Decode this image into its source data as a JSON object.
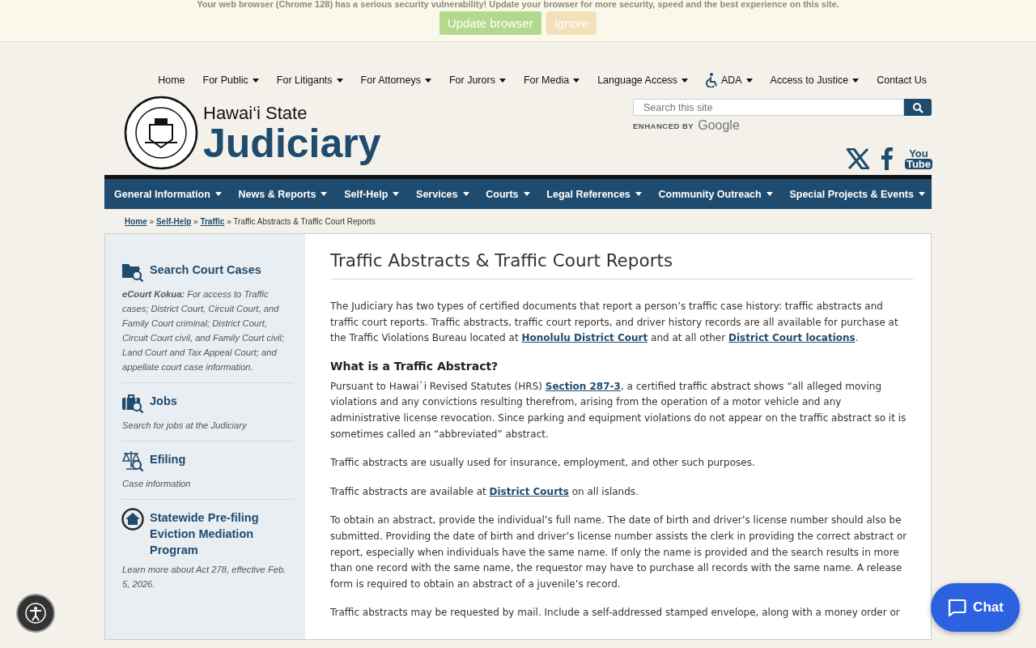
{
  "banner": {
    "message": "Your web browser (Chrome 128) has a serious security vulnerability! Update your browser for more security, speed and the best experience on this site.",
    "buttons": [
      {
        "label": "Update browser",
        "kind": "primary"
      },
      {
        "label": "Ignore",
        "kind": "secondary"
      }
    ]
  },
  "top_nav": [
    {
      "label": "Home",
      "kind": "link"
    },
    {
      "label": "For Public",
      "kind": "menu"
    },
    {
      "label": "For Litigants",
      "kind": "menu"
    },
    {
      "label": "For Attorneys",
      "kind": "menu"
    },
    {
      "label": "For Jurors",
      "kind": "menu"
    },
    {
      "label": "For Media",
      "kind": "menu"
    },
    {
      "label": "Language Access",
      "kind": "menu"
    },
    {
      "label": "ADA",
      "kind": "ada"
    },
    {
      "label": "Access to Justice",
      "kind": "menu"
    },
    {
      "label": "Contact Us",
      "kind": "link"
    }
  ],
  "logo": {
    "line1": "Hawai‘i State",
    "line2": "Judiciary"
  },
  "search": {
    "placeholder": "Search this site",
    "enhanced_by": "ENHANCED BY",
    "provider": "Google"
  },
  "social": {
    "youtube_top": "You",
    "youtube_bottom": "Tube"
  },
  "main_nav": [
    {
      "label": "General Information"
    },
    {
      "label": "News & Reports"
    },
    {
      "label": "Self-Help"
    },
    {
      "label": "Services"
    },
    {
      "label": "Courts"
    },
    {
      "label": "Legal References"
    },
    {
      "label": "Community Outreach"
    },
    {
      "label": "Special Projects & Events"
    }
  ],
  "breadcrumb_separator": "»",
  "breadcrumb": [
    {
      "label": "Home",
      "link": true
    },
    {
      "label": "Self-Help",
      "link": true
    },
    {
      "label": "Traffic",
      "link": true
    },
    {
      "label": "Traffic Abstracts & Traffic Court Reports",
      "link": false
    }
  ],
  "sidebar": [
    {
      "kind": "folder",
      "title": "Search Court Cases",
      "description": "**eCourt Kokua:** For access to Traffic cases; District Court, Circuit Court, and Family Court criminal; District Court, Circuit Court civil, and Family Court civil; Land Court and Tax Appeal Court; and appellate court case information."
    },
    {
      "kind": "briefcase",
      "title": "Jobs",
      "description": "Search for jobs at the Judiciary"
    },
    {
      "kind": "scales",
      "title": "Efiling",
      "description": "Case information"
    },
    {
      "kind": "house",
      "title": "Statewide Pre-filing Eviction Mediation Program",
      "description": "Learn more about Act 278, effective Feb. 5, 2026."
    }
  ],
  "content": {
    "title": "Traffic Abstracts & Traffic Court Reports",
    "blocks": [
      {
        "kind": "paragraph",
        "parts": [
          {
            "text": "The Judiciary has two types of certified documents that report a person’s traffic case history: traffic abstracts and traffic court reports.  Traffic abstracts, traffic court reports, and driver history records are all available for purchase at the Traffic Violations Bureau located at "
          },
          {
            "text": "Honolulu District Court",
            "link": true
          },
          {
            "text": " and at all other  "
          },
          {
            "text": "District Court locations",
            "link": true
          },
          {
            "text": "."
          }
        ]
      },
      {
        "kind": "heading",
        "parts": [
          {
            "text": "What is a Traffic Abstract?"
          }
        ]
      },
      {
        "kind": "paragraph",
        "parts": [
          {
            "text": "Pursuant to Hawai`i Revised Statutes (HRS) "
          },
          {
            "text": "Section 287-3",
            "link": true
          },
          {
            "text": ", a certified traffic abstract shows “all alleged moving violations and any convictions resulting therefrom, arising from the operation of a motor vehicle and any administrative license revocation.  Since parking and equipment violations do not appear on the traffic abstract so it is sometimes called an “abbreviated” abstract."
          }
        ]
      },
      {
        "kind": "paragraph",
        "parts": [
          {
            "text": "Traffic abstracts are usually used for insurance, employment, and other such purposes."
          }
        ]
      },
      {
        "kind": "paragraph",
        "parts": [
          {
            "text": "Traffic abstracts are available at "
          },
          {
            "text": "District Courts",
            "link": true
          },
          {
            "text": " on all islands."
          }
        ]
      },
      {
        "kind": "paragraph",
        "parts": [
          {
            "text": "To obtain an abstract, provide the individual’s full name. The date of birth and driver’s license number should also be submitted. Providing the date of birth and driver’s license number assists the clerk in providing the correct abstract or report, especially when individuals have the same name. If only the name is provided and the search results in more than one record with the same name, the requestor may have to purchase all records with the same name. A release form is required to obtain an abstract of a juvenile’s record."
          }
        ]
      },
      {
        "kind": "paragraph",
        "parts": [
          {
            "text": "Traffic abstracts may be requested by mail. Include a self-addressed stamped envelope, along with a money order or"
          }
        ]
      }
    ]
  },
  "chat": {
    "label": "Chat"
  }
}
